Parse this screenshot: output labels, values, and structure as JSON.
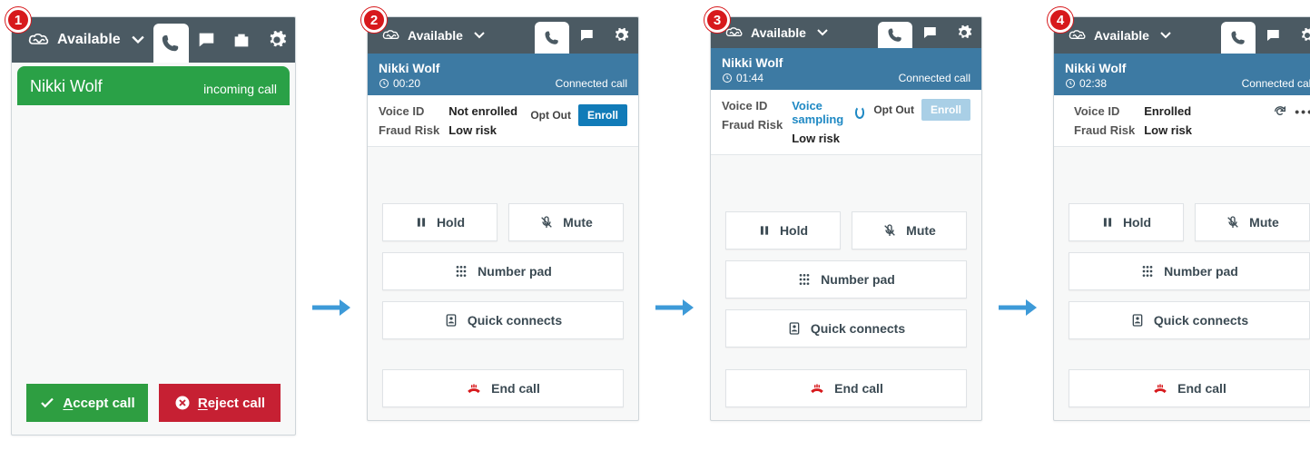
{
  "status_label": "Available",
  "panel1": {
    "caller_name": "Nikki Wolf",
    "sub": "incoming call",
    "accept": "Accept call",
    "reject": "Reject call"
  },
  "panel2": {
    "caller_name": "Nikki Wolf",
    "timer": "00:20",
    "sub": "Connected call",
    "voiceid_label": "Voice ID",
    "voiceid_value": "Not enrolled",
    "fraud_label": "Fraud Risk",
    "fraud_value": "Low risk",
    "optout": "Opt Out",
    "enroll": "Enroll"
  },
  "panel3": {
    "caller_name": "Nikki Wolf",
    "timer": "01:44",
    "sub": "Connected call",
    "voiceid_label": "Voice ID",
    "voiceid_value": "Voice sampling",
    "fraud_label": "Fraud Risk",
    "fraud_value": "Low risk",
    "optout": "Opt Out",
    "enroll": "Enroll"
  },
  "panel4": {
    "caller_name": "Nikki Wolf",
    "timer": "02:38",
    "sub": "Connected call",
    "voiceid_label": "Voice ID",
    "voiceid_value": "Enrolled",
    "fraud_label": "Fraud Risk",
    "fraud_value": "Low risk"
  },
  "controls": {
    "hold": "Hold",
    "mute": "Mute",
    "numberpad": "Number pad",
    "quickconnects": "Quick connects",
    "endcall": "End call"
  },
  "steps": {
    "s1": "1",
    "s2": "2",
    "s3": "3",
    "s4": "4"
  }
}
